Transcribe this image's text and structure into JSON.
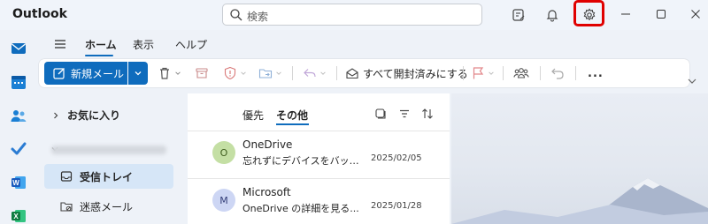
{
  "app": {
    "title": "Outlook"
  },
  "search": {
    "placeholder": "検索"
  },
  "titlebar_icons": [
    "note-icon",
    "bell-icon",
    "gear-icon"
  ],
  "window_controls": [
    "minimize",
    "maximize",
    "close"
  ],
  "rail": [
    "mail",
    "calendar",
    "people",
    "todo",
    "word",
    "excel"
  ],
  "menu": {
    "tabs": [
      "ホーム",
      "表示",
      "ヘルプ"
    ],
    "active": "ホーム"
  },
  "toolbar": {
    "new_mail": "新規メール",
    "mark_all_read": "すべて開封済みにする",
    "more": "..."
  },
  "folders": {
    "favorites": "お気に入り",
    "items": [
      {
        "label": "受信トレイ",
        "selected": true
      },
      {
        "label": "迷惑メール",
        "selected": false
      }
    ]
  },
  "list": {
    "filters": [
      "優先",
      "その他"
    ],
    "active_filter": "その他",
    "messages": [
      {
        "initial": "O",
        "sender": "OneDrive",
        "subject": "忘れずにデバイスをバックアップ...",
        "date": "2025/02/05",
        "avatar_color": "#c4dfa4"
      },
      {
        "initial": "M",
        "sender": "Microsoft",
        "subject": "OneDrive の詳細を見る...",
        "date": "2025/01/28",
        "avatar_color": "#cdd6f4"
      }
    ]
  },
  "colors": {
    "accent": "#0f6cbd",
    "highlight": "#e00000"
  }
}
